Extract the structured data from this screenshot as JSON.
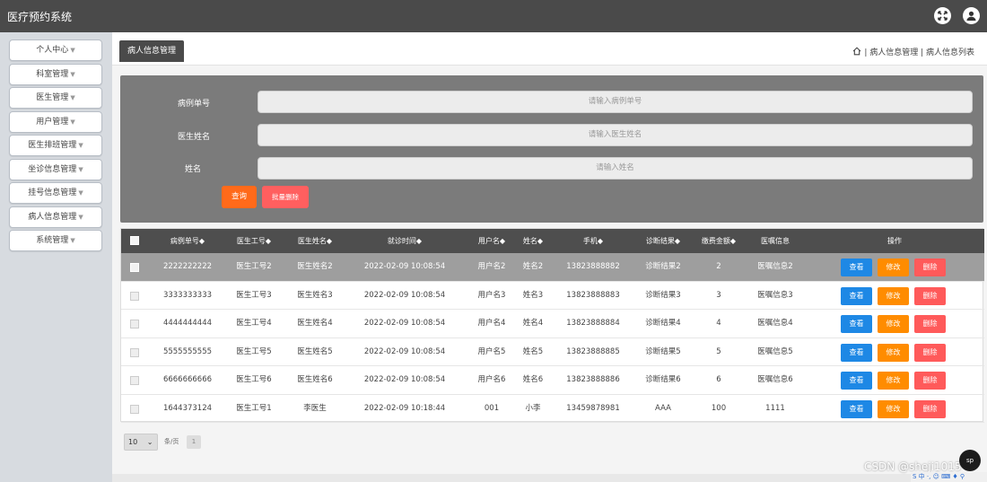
{
  "app": {
    "title": "医疗预约系统"
  },
  "topbar": {
    "icons": [
      "fullscreen-icon",
      "user-icon"
    ]
  },
  "sidebar": {
    "items": [
      {
        "label": "个人中心"
      },
      {
        "label": "科室管理"
      },
      {
        "label": "医生管理"
      },
      {
        "label": "用户管理"
      },
      {
        "label": "医生排班管理"
      },
      {
        "label": "坐诊信息管理"
      },
      {
        "label": "挂号信息管理"
      },
      {
        "label": "病人信息管理"
      },
      {
        "label": "系统管理"
      }
    ]
  },
  "tabs": [
    {
      "label": "病人信息管理"
    }
  ],
  "breadcrumb": {
    "text": "病人信息管理 | 病人信息列表",
    "sep": "|"
  },
  "search": {
    "fields": [
      {
        "label": "病例单号",
        "placeholder": "请输入病例单号"
      },
      {
        "label": "医生姓名",
        "placeholder": "请输入医生姓名"
      },
      {
        "label": "姓名",
        "placeholder": "请输入姓名"
      }
    ],
    "query_label": "查询",
    "batch_delete_label": "批量删除"
  },
  "table": {
    "headers": [
      "病例单号",
      "医生工号",
      "医生姓名",
      "就诊时间",
      "用户名",
      "姓名",
      "手机",
      "诊断结果",
      "缴费金额",
      "医嘱信息",
      "操作"
    ],
    "sort_mark": "◆",
    "actions": {
      "view": "查看",
      "edit": "修改",
      "delete": "删除"
    },
    "rows": [
      [
        "2222222222",
        "医生工号2",
        "医生姓名2",
        "2022-02-09 10:08:54",
        "用户名2",
        "姓名2",
        "13823888882",
        "诊断结果2",
        "2",
        "医嘱信息2"
      ],
      [
        "3333333333",
        "医生工号3",
        "医生姓名3",
        "2022-02-09 10:08:54",
        "用户名3",
        "姓名3",
        "13823888883",
        "诊断结果3",
        "3",
        "医嘱信息3"
      ],
      [
        "4444444444",
        "医生工号4",
        "医生姓名4",
        "2022-02-09 10:08:54",
        "用户名4",
        "姓名4",
        "13823888884",
        "诊断结果4",
        "4",
        "医嘱信息4"
      ],
      [
        "5555555555",
        "医生工号5",
        "医生姓名5",
        "2022-02-09 10:08:54",
        "用户名5",
        "姓名5",
        "13823888885",
        "诊断结果5",
        "5",
        "医嘱信息5"
      ],
      [
        "6666666666",
        "医生工号6",
        "医生姓名6",
        "2022-02-09 10:08:54",
        "用户名6",
        "姓名6",
        "13823888886",
        "诊断结果6",
        "6",
        "医嘱信息6"
      ],
      [
        "1644373124",
        "医生工号1",
        "李医生",
        "2022-02-09 10:18:44",
        "001",
        "小李",
        "13459878981",
        "AAA",
        "100",
        "1111"
      ]
    ]
  },
  "pager": {
    "page_size": "10",
    "per_page_label": "条/页",
    "page_button": "1"
  },
  "watermark": "CSDN @sheji1015",
  "float_button": "sp",
  "ime_bar": "S 中 ·, ☺ ⌨ ♦ ⚲"
}
